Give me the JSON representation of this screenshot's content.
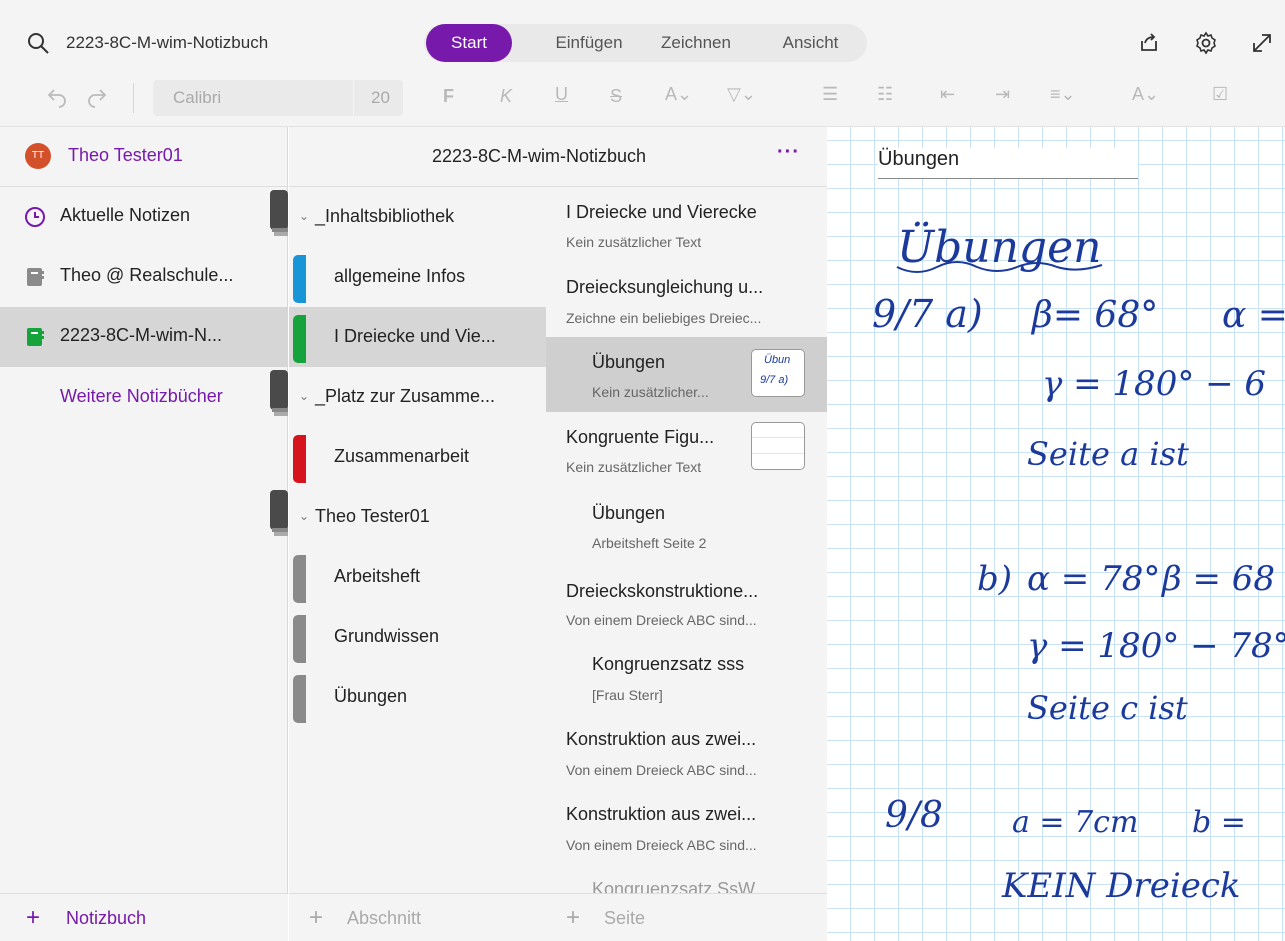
{
  "header": {
    "notebook_title": "2223-8C-M-wim-Notizbuch",
    "tabs": [
      "Start",
      "Einfügen",
      "Zeichnen",
      "Ansicht"
    ],
    "active_tab": "Start",
    "font_name": "Calibri",
    "font_size": "20",
    "accent_color": "#7719aa"
  },
  "user": {
    "initials": "TT",
    "name": "Theo Tester01"
  },
  "notebooks": [
    {
      "label": "Aktuelle Notizen",
      "icon": "clock-icon"
    },
    {
      "label": "Theo @ Realschule...",
      "icon": "notebook-icon"
    },
    {
      "label": "2223-8C-M-wim-N...",
      "icon": "notebook-green-icon",
      "selected": true
    }
  ],
  "more_notebooks": "Weitere Notizbücher",
  "sections_header": "2223-8C-M-wim-Notizbuch",
  "sections": {
    "group1": "_Inhaltsbibliothek",
    "s1": "allgemeine Infos",
    "s2": "I Dreiecke und Vie...",
    "group2": "_Platz zur Zusamme...",
    "s3": "Zusammenarbeit",
    "group3": "Theo Tester01",
    "s4": "Arbeitsheft",
    "s5": "Grundwissen",
    "s6": "Übungen"
  },
  "pages": [
    {
      "title": "I Dreiecke und Vierecke",
      "sub": "Kein zusätzlicher Text"
    },
    {
      "title": "Dreiecksungleichung u...",
      "sub": "Zeichne ein beliebiges Dreiec..."
    },
    {
      "title": "Übungen",
      "sub": "Kein zusätzlicher..."
    },
    {
      "title": "Kongruente Figu...",
      "sub": "Kein zusätzlicher Text"
    },
    {
      "title": "Übungen",
      "sub": "Arbeitsheft Seite 2"
    },
    {
      "title": "Dreieckskonstruktione...",
      "sub": "Von einem Dreieck ABC sind..."
    },
    {
      "title": "Kongruenzsatz sss",
      "sub": "[Frau Sterr]"
    },
    {
      "title": "Konstruktion aus zwei...",
      "sub": "Von einem Dreieck ABC sind..."
    },
    {
      "title": "Konstruktion aus zwei...",
      "sub": "Von einem Dreieck ABC sind..."
    },
    {
      "title": "Kongruenzsatz SsW",
      "sub": ""
    }
  ],
  "footer": {
    "notebook": "Notizbuch",
    "section": "Abschnitt",
    "page": "Seite"
  },
  "page_title": "Übungen",
  "handwriting": {
    "heading": "Übungen",
    "l1a": "9/7 a)",
    "l1b": "β= 68°",
    "l1c": "α =",
    "l2": "γ = 180° − 6",
    "l3": "Seite a ist",
    "l4a": "b)",
    "l4b": "α = 78°",
    "l4c": "β = 68",
    "l5": "γ = 180° − 78°",
    "l6": "Seite c ist",
    "l7a": "9/8",
    "l7b": "a = 7cm",
    "l7c": "b =",
    "l8": "KEIN Dreieck",
    "thumb1": "Übun",
    "thumb2": "9/7 a)"
  }
}
